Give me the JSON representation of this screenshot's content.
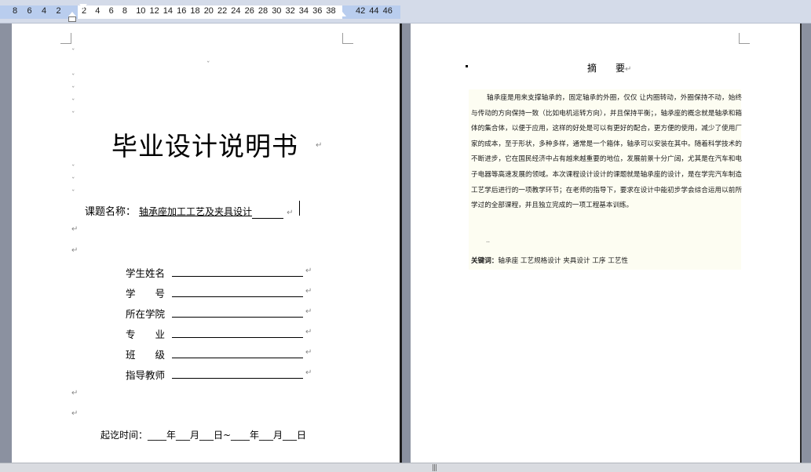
{
  "ruler": {
    "labels_left": [
      "8",
      "6",
      "4",
      "2"
    ],
    "labels_main": [
      "2",
      "4",
      "6",
      "8",
      "10",
      "12",
      "14",
      "16",
      "18",
      "20",
      "22",
      "24",
      "26",
      "28",
      "30",
      "32",
      "34",
      "36",
      "38"
    ],
    "labels_right": [
      "42",
      "44",
      "46"
    ]
  },
  "cover": {
    "title": "毕业设计说明书",
    "topic_label": "课题名称：",
    "topic_value": "轴承座加工工艺及夹具设计",
    "fields": [
      {
        "label": "学生姓名"
      },
      {
        "label": "学　　号"
      },
      {
        "label": "所在学院"
      },
      {
        "label": "专　　业"
      },
      {
        "label": "班　　级"
      },
      {
        "label": "指导教师"
      }
    ],
    "date_line": "起讫时间：____年___月___日~____年___月___日",
    "return_mark": "↵"
  },
  "abstract": {
    "title": "摘　　要",
    "body": "轴承座是用来支撑轴承的，固定轴承的外圈，仅仅 让内圈转动，外圈保持不动，始终与传动的方向保持一致（比如电机运转方向），并且保持平衡；，轴承座的概念就是轴承和箱体的集合体，以便于应用，这样的好处是可以有更好的配合，更方便的使用，减少了使用厂家的成本，至于形状，多种多样，通常是一个箱体，轴承可以安装在其中。随着科学技术的不断进步，它在国民经济中占有越来越重要的地位，发展前景十分广阔，尤其是在汽车和电子电器等高速发展的领域。本次课程设计设计的课题就是轴承座的设计，是在学完汽车制造工艺学后进行的一项教学环节；在老师的指导下，要求在设计中能初步学会综合运用以前所学过的全部课程，并且独立完成的一项工程基本训练。",
    "keywords_label": "关键词：",
    "keywords_value": "轴承座 工艺规格设计 夹具设计 工序 工艺性",
    "trailing_mark": "↵"
  }
}
